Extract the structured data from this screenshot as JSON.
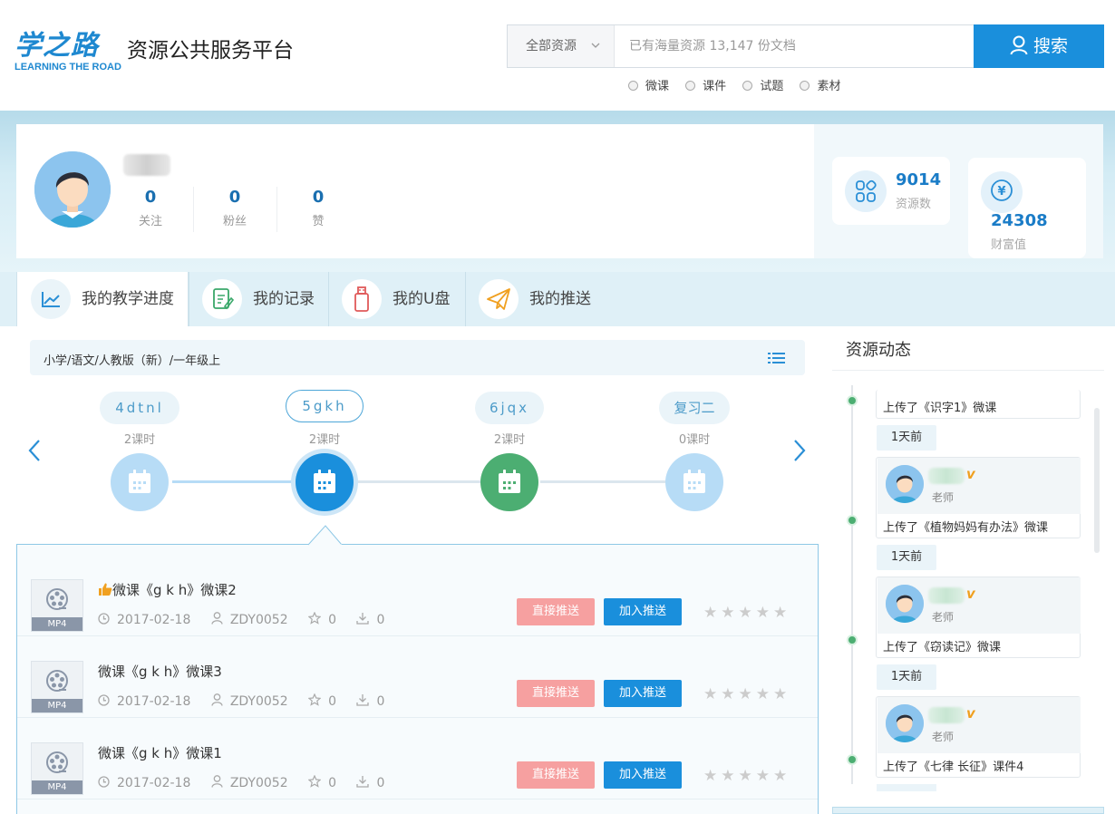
{
  "header": {
    "logo_cn": "学之路",
    "logo_en": "LEARNING THE ROAD",
    "platform_name": "资源公共服务平台",
    "search": {
      "category": "全部资源",
      "placeholder": "已有海量资源 13,147 份文档",
      "button": "搜索"
    },
    "filters": [
      "微课",
      "课件",
      "试题",
      "素材"
    ]
  },
  "profile": {
    "follow": {
      "count": "0",
      "label": "关注"
    },
    "fans": {
      "count": "0",
      "label": "粉丝"
    },
    "likes": {
      "count": "0",
      "label": "赞"
    },
    "resources": {
      "count": "9014",
      "label": "资源数"
    },
    "wealth": {
      "count": "24308",
      "label": "财富值"
    },
    "wealth_icon": "¥"
  },
  "tabs": [
    {
      "label": "我的教学进度",
      "icon": "line-chart-icon"
    },
    {
      "label": "我的记录",
      "icon": "note-edit-icon"
    },
    {
      "label": "我的U盘",
      "icon": "usb-drive-icon"
    },
    {
      "label": "我的推送",
      "icon": "paper-plane-icon"
    }
  ],
  "breadcrumb": "小学/语文/人教版（新）/一年级上",
  "lessons": [
    {
      "name": "4dtnl",
      "hours": "2课时",
      "state": "pending"
    },
    {
      "name": "5gkh",
      "hours": "2课时",
      "state": "active"
    },
    {
      "name": "6jqx",
      "hours": "2课时",
      "state": "done"
    },
    {
      "name": "复习二",
      "hours": "0课时",
      "state": "pending"
    }
  ],
  "resources": [
    {
      "title": "微课《g k h》微课2",
      "type": "MP4",
      "date": "2017-02-18",
      "author": "ZDY0052",
      "favorites": "0",
      "downloads": "0",
      "recommended": true
    },
    {
      "title": "微课《g k h》微课3",
      "type": "MP4",
      "date": "2017-02-18",
      "author": "ZDY0052",
      "favorites": "0",
      "downloads": "0",
      "recommended": false
    },
    {
      "title": "微课《g k h》微课1",
      "type": "MP4",
      "date": "2017-02-18",
      "author": "ZDY0052",
      "favorites": "0",
      "downloads": "0",
      "recommended": false
    }
  ],
  "resource_actions": {
    "push": "直接推送",
    "add": "加入推送"
  },
  "sidebar": {
    "title": "资源动态",
    "feed": [
      {
        "text": "上传了《识字1》微课",
        "time": "1天前"
      },
      {
        "text": "上传了《植物妈妈有办法》微课",
        "role": "老师",
        "time": "1天前"
      },
      {
        "text": "上传了《窃读记》微课",
        "role": "老师",
        "time": "1天前"
      },
      {
        "text": "上传了《七律 长征》课件4",
        "role": "老师"
      }
    ],
    "vip_badge": "v"
  }
}
